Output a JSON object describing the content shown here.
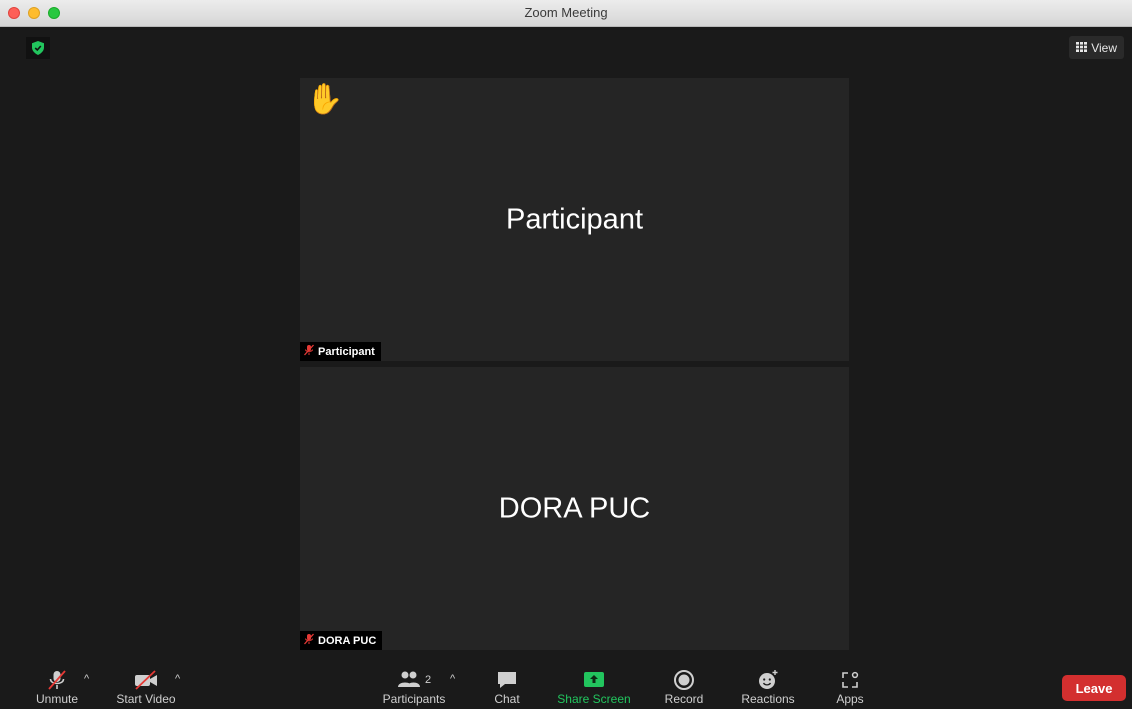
{
  "window": {
    "title": "Zoom Meeting"
  },
  "view_button": {
    "label": "View"
  },
  "tiles": [
    {
      "name": "Participant",
      "label": "Participant",
      "hand_raised": true
    },
    {
      "name": "DORA PUC",
      "label": "DORA PUC",
      "hand_raised": false
    }
  ],
  "toolbar": {
    "unmute": "Unmute",
    "start_video": "Start Video",
    "participants": "Participants",
    "participant_count": "2",
    "chat": "Chat",
    "share_screen": "Share Screen",
    "record": "Record",
    "reactions": "Reactions",
    "apps": "Apps",
    "leave": "Leave"
  },
  "colors": {
    "share_green": "#22c55e",
    "leave_red": "#d32f2f",
    "shield_green": "#22c55e"
  }
}
